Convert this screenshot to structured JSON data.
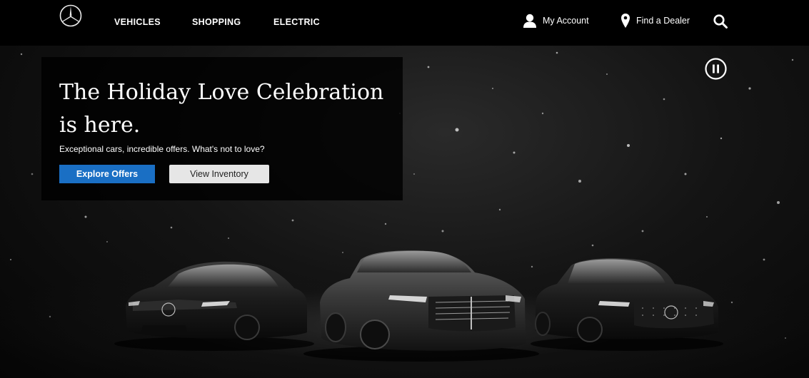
{
  "header": {
    "nav": [
      {
        "label": "VEHICLES"
      },
      {
        "label": "SHOPPING"
      },
      {
        "label": "ELECTRIC"
      }
    ],
    "my_account_label": "My Account",
    "find_dealer_label": "Find a Dealer"
  },
  "hero": {
    "headline": "The Holiday Love Celebration is here.",
    "subtext": "Exceptional cars, incredible offers. What's not to love?",
    "primary_button": "Explore Offers",
    "secondary_button": "View Inventory"
  },
  "icons": {
    "logo": "mercedes-star-logo",
    "account": "user-icon",
    "dealer": "map-pin-icon",
    "search": "search-icon",
    "pause": "pause-icon"
  },
  "colors": {
    "primary_button": "#1a6fc4",
    "secondary_button": "#e6e6e6",
    "background": "#000000"
  }
}
